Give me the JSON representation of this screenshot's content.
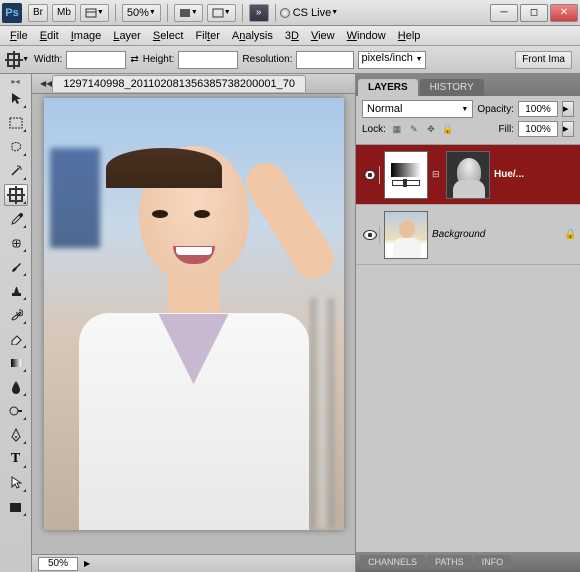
{
  "titlebar": {
    "ps": "Ps",
    "br": "Br",
    "mb": "Mb",
    "zoom": "50%",
    "cs_live": "CS Live"
  },
  "menubar": {
    "items": [
      "File",
      "Edit",
      "Image",
      "Layer",
      "Select",
      "Filter",
      "Analysis",
      "3D",
      "View",
      "Window",
      "Help"
    ]
  },
  "optbar": {
    "width_label": "Width:",
    "height_label": "Height:",
    "res_label": "Resolution:",
    "unit": "pixels/inch",
    "front_img": "Front Ima"
  },
  "document": {
    "tab_title": "1297140998_201102081356385738200001_70",
    "zoom_status": "50%"
  },
  "panels": {
    "tabs": [
      "LAYERS",
      "HISTORY"
    ],
    "blend_mode": "Normal",
    "opacity_label": "Opacity:",
    "opacity_value": "100%",
    "lock_label": "Lock:",
    "fill_label": "Fill:",
    "fill_value": "100%",
    "layers": [
      {
        "name": "Hue/...",
        "type": "adjustment",
        "selected": true,
        "visible": true
      },
      {
        "name": "Background",
        "type": "image",
        "selected": false,
        "visible": true,
        "locked": true
      }
    ],
    "bottom_tabs": [
      "CHANNELS",
      "PATHS",
      "INFO"
    ]
  }
}
